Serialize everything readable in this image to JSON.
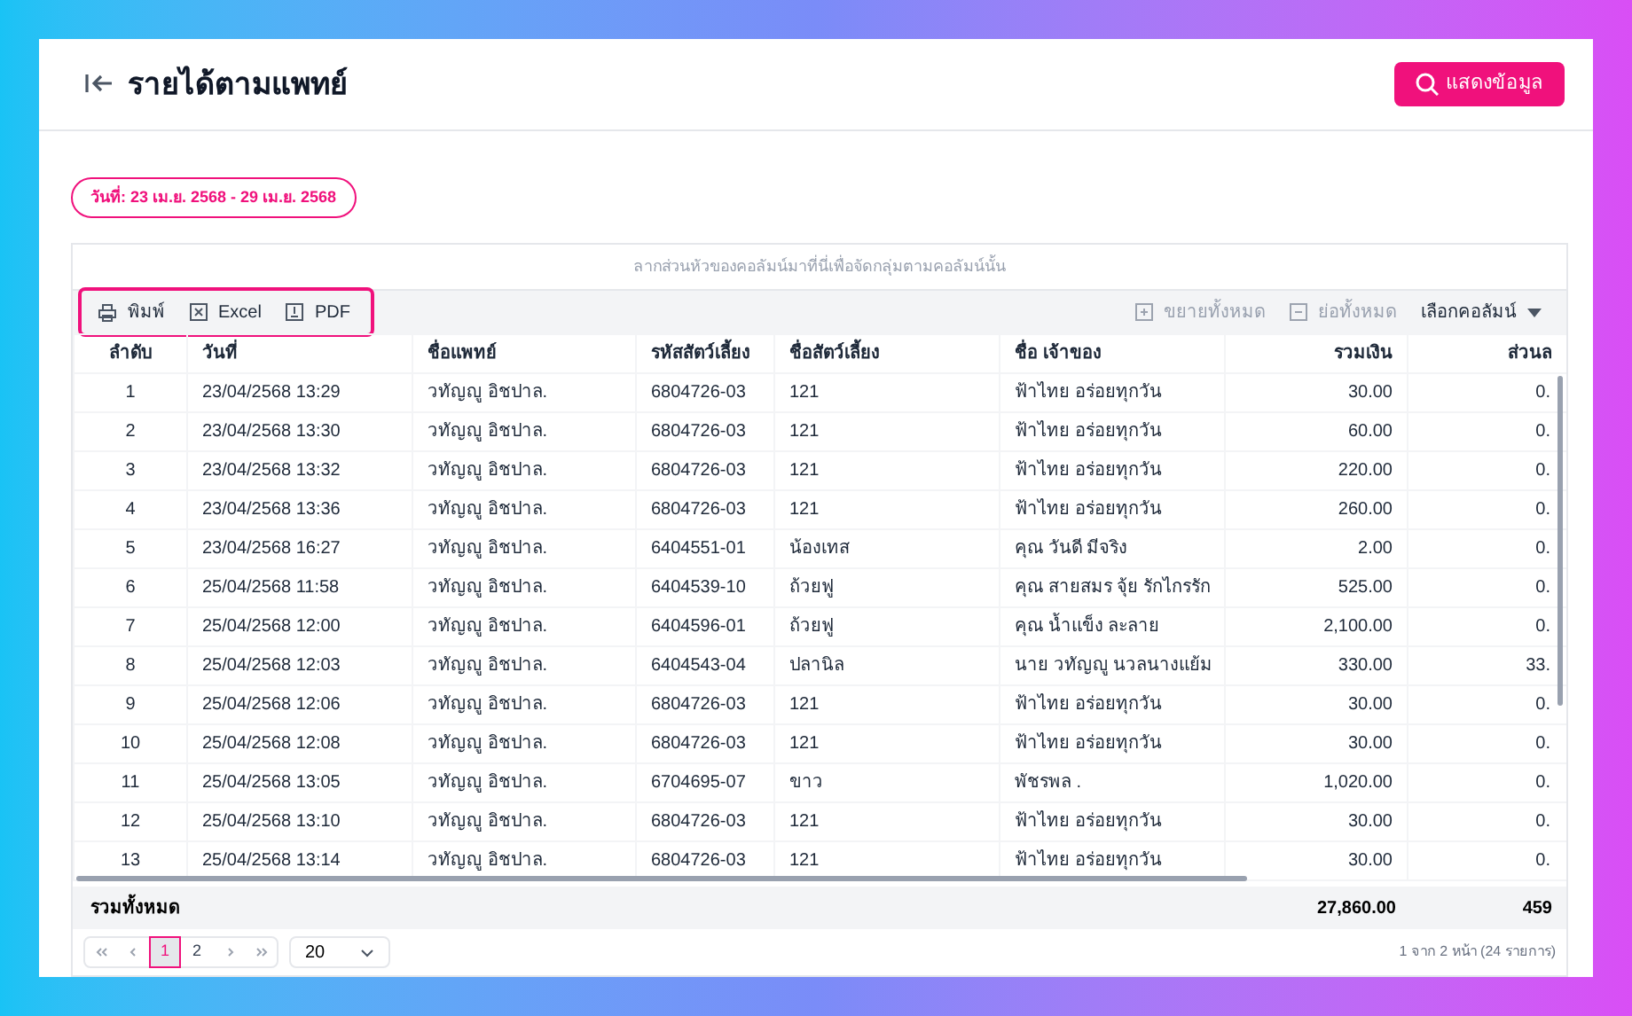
{
  "header": {
    "title": "รายได้ตามแพทย์",
    "show_button": "แสดงข้อมูล"
  },
  "date_badge": "วันที่: 23 เม.ย. 2568 - 29 เม.ย. 2568",
  "group_panel": "ลากส่วนหัวของคอลัมน์มาที่นี่เพื่อจัดกลุ่มตามคอลัมน์นั้น",
  "toolbar": {
    "left": [
      {
        "kind": "print",
        "label": "พิมพ์"
      },
      {
        "kind": "excel",
        "label": "Excel"
      },
      {
        "kind": "pdf",
        "label": "PDF"
      }
    ],
    "right": [
      {
        "kind": "expand",
        "label": "ขยายทั้งหมด",
        "disabled": true
      },
      {
        "kind": "collapse",
        "label": "ย่อทั้งหมด",
        "disabled": true
      },
      {
        "kind": "chooser",
        "label": "เลือกคอลัมน์",
        "disabled": false
      }
    ]
  },
  "table": {
    "columns": [
      "ลำดับ",
      "วันที่",
      "ชื่อแพทย์",
      "รหัสสัตว์เลี้ยง",
      "ชื่อสัตว์เลี้ยง",
      "ชื่อ เจ้าของ",
      "รวมเงิน",
      "ส่วนล"
    ],
    "rows": [
      [
        "1",
        "23/04/2568 13:29",
        "วทัญญู อิชปาล.",
        "6804726-03",
        "121",
        "ฟ้าไทย อร่อยทุกวัน",
        "30.00",
        "0."
      ],
      [
        "2",
        "23/04/2568 13:30",
        "วทัญญู อิชปาล.",
        "6804726-03",
        "121",
        "ฟ้าไทย อร่อยทุกวัน",
        "60.00",
        "0."
      ],
      [
        "3",
        "23/04/2568 13:32",
        "วทัญญู อิชปาล.",
        "6804726-03",
        "121",
        "ฟ้าไทย อร่อยทุกวัน",
        "220.00",
        "0."
      ],
      [
        "4",
        "23/04/2568 13:36",
        "วทัญญู อิชปาล.",
        "6804726-03",
        "121",
        "ฟ้าไทย อร่อยทุกวัน",
        "260.00",
        "0."
      ],
      [
        "5",
        "23/04/2568 16:27",
        "วทัญญู อิชปาล.",
        "6404551-01",
        "น้องเทส",
        "คุณ วันดี มีจริง",
        "2.00",
        "0."
      ],
      [
        "6",
        "25/04/2568 11:58",
        "วทัญญู อิชปาล.",
        "6404539-10",
        "ถ้วยฟู",
        "คุณ สายสมร จุ้ย รักไกรรัก",
        "525.00",
        "0."
      ],
      [
        "7",
        "25/04/2568 12:00",
        "วทัญญู อิชปาล.",
        "6404596-01",
        "ถ้วยฟู",
        "คุณ น้ำแข็ง ละลาย",
        "2,100.00",
        "0."
      ],
      [
        "8",
        "25/04/2568 12:03",
        "วทัญญู อิชปาล.",
        "6404543-04",
        "ปลานิล",
        "นาย วทัญญู นวลนางแย้ม",
        "330.00",
        "33."
      ],
      [
        "9",
        "25/04/2568 12:06",
        "วทัญญู อิชปาล.",
        "6804726-03",
        "121",
        "ฟ้าไทย อร่อยทุกวัน",
        "30.00",
        "0."
      ],
      [
        "10",
        "25/04/2568 12:08",
        "วทัญญู อิชปาล.",
        "6804726-03",
        "121",
        "ฟ้าไทย อร่อยทุกวัน",
        "30.00",
        "0."
      ],
      [
        "11",
        "25/04/2568 13:05",
        "วทัญญู อิชปาล.",
        "6704695-07",
        "ขาว",
        "พัชรพล .",
        "1,020.00",
        "0."
      ],
      [
        "12",
        "25/04/2568 13:10",
        "วทัญญู อิชปาล.",
        "6804726-03",
        "121",
        "ฟ้าไทย อร่อยทุกวัน",
        "30.00",
        "0."
      ],
      [
        "13",
        "25/04/2568 13:14",
        "วทัญญู อิชปาล.",
        "6804726-03",
        "121",
        "ฟ้าไทย อร่อยทุกวัน",
        "30.00",
        "0."
      ]
    ],
    "totals": {
      "label": "รวมทั้งหมด",
      "amount": "27,860.00",
      "discount": "459"
    }
  },
  "pagination": {
    "pages": [
      {
        "label": "1",
        "selected": true
      },
      {
        "label": "2",
        "selected": false
      }
    ],
    "page_size": "20",
    "info": "1 จาก 2 หน้า (24 รายการ)"
  }
}
